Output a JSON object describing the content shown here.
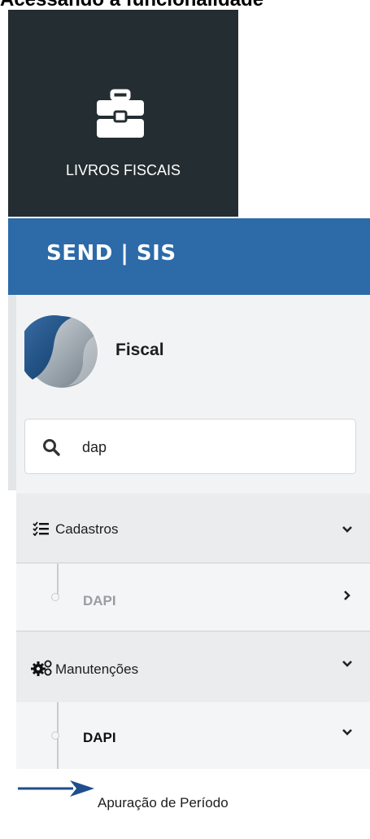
{
  "doc_heading": "Acessando a funcionalidade",
  "tile": {
    "label": "LIVROS FISCAIS",
    "icon": "toolbox-icon"
  },
  "brand": "SEND | SIS",
  "module": {
    "title": "Fiscal",
    "logo": "module-logo"
  },
  "search": {
    "value": "dap",
    "icon": "search-icon"
  },
  "menu": {
    "cadastros": {
      "label": "Cadastros",
      "icon": "checklist-icon"
    },
    "cadastros_dapi": {
      "label": "DAPI"
    },
    "manutencoes": {
      "label": "Manutenções",
      "icon": "gears-icon"
    },
    "manutencoes_dapi": {
      "label": "DAPI"
    },
    "apuracao": {
      "label": "Apuração de Período"
    }
  },
  "colors": {
    "tile_bg": "#242d31",
    "brand_bar": "#2c6aa8",
    "sidebar_bg": "#f2f3f4",
    "arrow": "#1f4e8c"
  }
}
